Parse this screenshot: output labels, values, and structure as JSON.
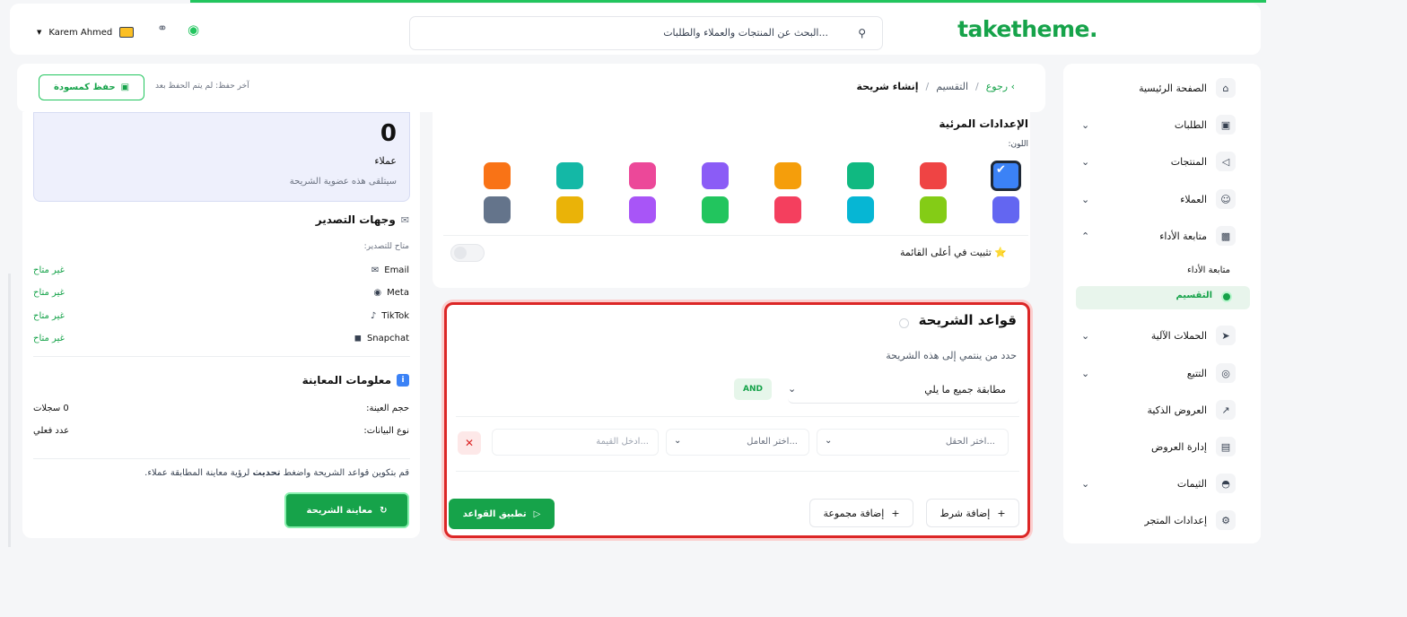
{
  "app": {
    "logo": "taketheme."
  },
  "topbar": {
    "search_placeholder": "البحث عن المنتجات والعملاء والطلبات...",
    "user_name": "Karem Ahmed"
  },
  "sidebar": {
    "items": [
      {
        "label": "الصفحة الرئيسية"
      },
      {
        "label": "الطلبات"
      },
      {
        "label": "المنتجات"
      },
      {
        "label": "العملاء"
      },
      {
        "label": "متابعة الأداء"
      },
      {
        "label": "الحملات الآلية"
      },
      {
        "label": "التتبع"
      },
      {
        "label": "العروض الذكية"
      },
      {
        "label": "إدارة العروض"
      },
      {
        "label": "الثيمات"
      },
      {
        "label": "إعدادات المتجر"
      }
    ],
    "subitems": [
      {
        "label": "متابعة الأداء"
      },
      {
        "label": "التقسيم"
      }
    ]
  },
  "header": {
    "back": "رجوع",
    "crumb_mid": "التقسيم",
    "crumb_current": "إنشاء شريحة",
    "save_draft": "حفظ كمسودة",
    "last_saved": "آخر حفظ: لم يتم الحفظ بعد"
  },
  "visual": {
    "title": "الإعدادات المرئية",
    "color_label": "اللون:",
    "colors_row1": [
      "#3b82f6",
      "#ef4444",
      "#10b981",
      "#f59e0b",
      "#8b5cf6",
      "#ec4899",
      "#14b8a6",
      "#f97316"
    ],
    "colors_row2": [
      "#6366f1",
      "#84cc16",
      "#06b6d4",
      "#f43f5e",
      "#22c55e",
      "#a855f7",
      "#eab308",
      "#64748b"
    ],
    "pin_label": "⭐ تثبيت في أعلى القائمة"
  },
  "rules": {
    "title": "قواعد الشريحة",
    "subtitle": "حدد من ينتمي إلى هذه الشريحة",
    "match_value": "مطابقة جميع ما يلي",
    "and_badge": "AND",
    "field_placeholder": "اختر الحقل...",
    "operator_placeholder": "اختر العامل...",
    "value_placeholder": "ادخل القيمة...",
    "add_condition": "إضافة شرط",
    "add_group": "إضافة مجموعة",
    "apply": "تطبيق القواعد"
  },
  "preview": {
    "count": "0",
    "count_label": "عملاء",
    "count_desc": "سيتلقى هذه عضوية الشريحة",
    "export_title": "وجهات التصدير",
    "export_available": "متاح للتصدير:",
    "destinations": [
      {
        "name": "Email",
        "status": "غير متاح"
      },
      {
        "name": "Meta",
        "status": "غير متاح"
      },
      {
        "name": "TikTok",
        "status": "غير متاح"
      },
      {
        "name": "Snapchat",
        "status": "غير متاح"
      }
    ],
    "info_title": "معلومات المعاينة",
    "sample_label": "حجم العينة:",
    "sample_value": "0 سجلات",
    "data_type_label": "نوع البيانات:",
    "data_type_value": "عدد فعلي",
    "hint_pre": "قم بتكوين قواعد الشريحة واضغط ",
    "hint_bold": "تحديث",
    "hint_post": " لرؤية معاينة المطابقة عملاء.",
    "preview_button": "معاينة الشريحة"
  },
  "theme": {
    "accent": "#16a34a",
    "highlight": "#dc2626"
  }
}
